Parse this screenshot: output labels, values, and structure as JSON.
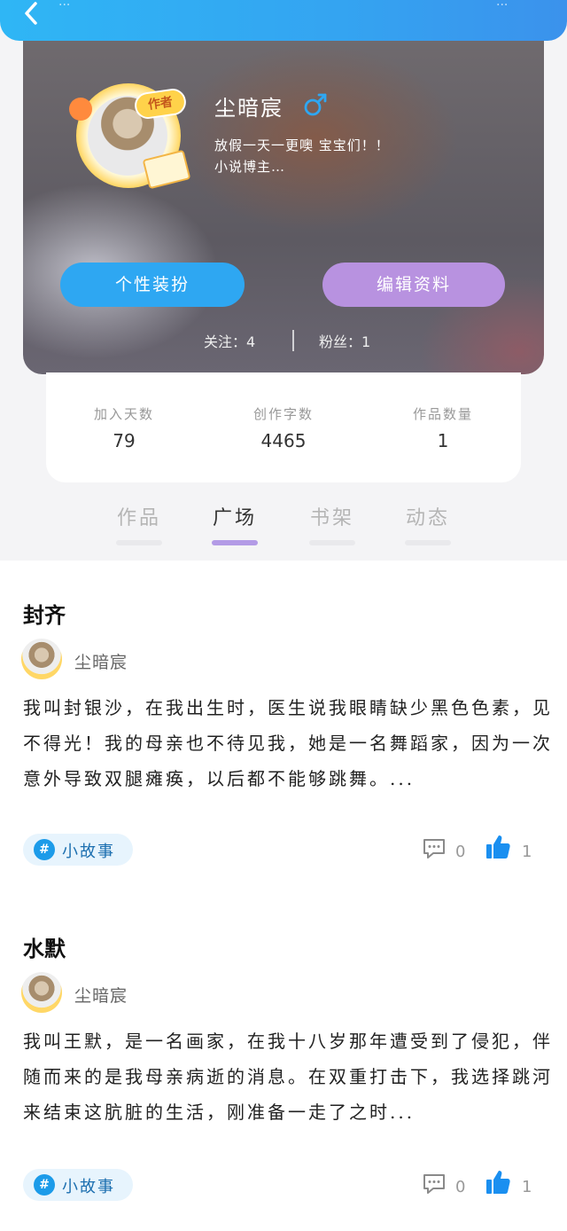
{
  "status_bar": {
    "left_fragment": "...",
    "right_fragment": "..."
  },
  "profile": {
    "author_badge": "作者",
    "username": "尘暗宸",
    "bio_line1": "放假一天一更噢 宝宝们！！",
    "bio_line2": "小说博主…",
    "dress_button": "个性装扮",
    "edit_button": "编辑资料",
    "following": "关注：4",
    "fans": "粉丝：1"
  },
  "stats": [
    {
      "label": "加入天数",
      "value": "79"
    },
    {
      "label": "创作字数",
      "value": "4465"
    },
    {
      "label": "作品数量",
      "value": "1"
    }
  ],
  "tabs": [
    {
      "label": "作品",
      "active": false
    },
    {
      "label": "广场",
      "active": true
    },
    {
      "label": "书架",
      "active": false
    },
    {
      "label": "动态",
      "active": false
    }
  ],
  "posts": [
    {
      "title": "封齐",
      "author": "尘暗宸",
      "body": "我叫封银沙，在我出生时，医生说我眼睛缺少黑色色素，见不得光！我的母亲也不待见我，她是一名舞蹈家，因为一次意外导致双腿瘫痪，以后都不能够跳舞。...",
      "tag": "小故事",
      "comments": "0",
      "likes": "1"
    },
    {
      "title": "水默",
      "author": "尘暗宸",
      "body": "我叫王默，是一名画家，在我十八岁那年遭受到了侵犯，伴随而来的是我母亲病逝的消息。在双重打击下，我选择跳河来结束这肮脏的生活，刚准备一走了之时...",
      "tag": "小故事",
      "comments": "0",
      "likes": "1"
    }
  ],
  "colors": {
    "accent_blue": "#2ea7f2",
    "accent_purple": "#b892e0",
    "tab_active_underline": "#b39be6",
    "like_blue": "#1a8ff0"
  }
}
